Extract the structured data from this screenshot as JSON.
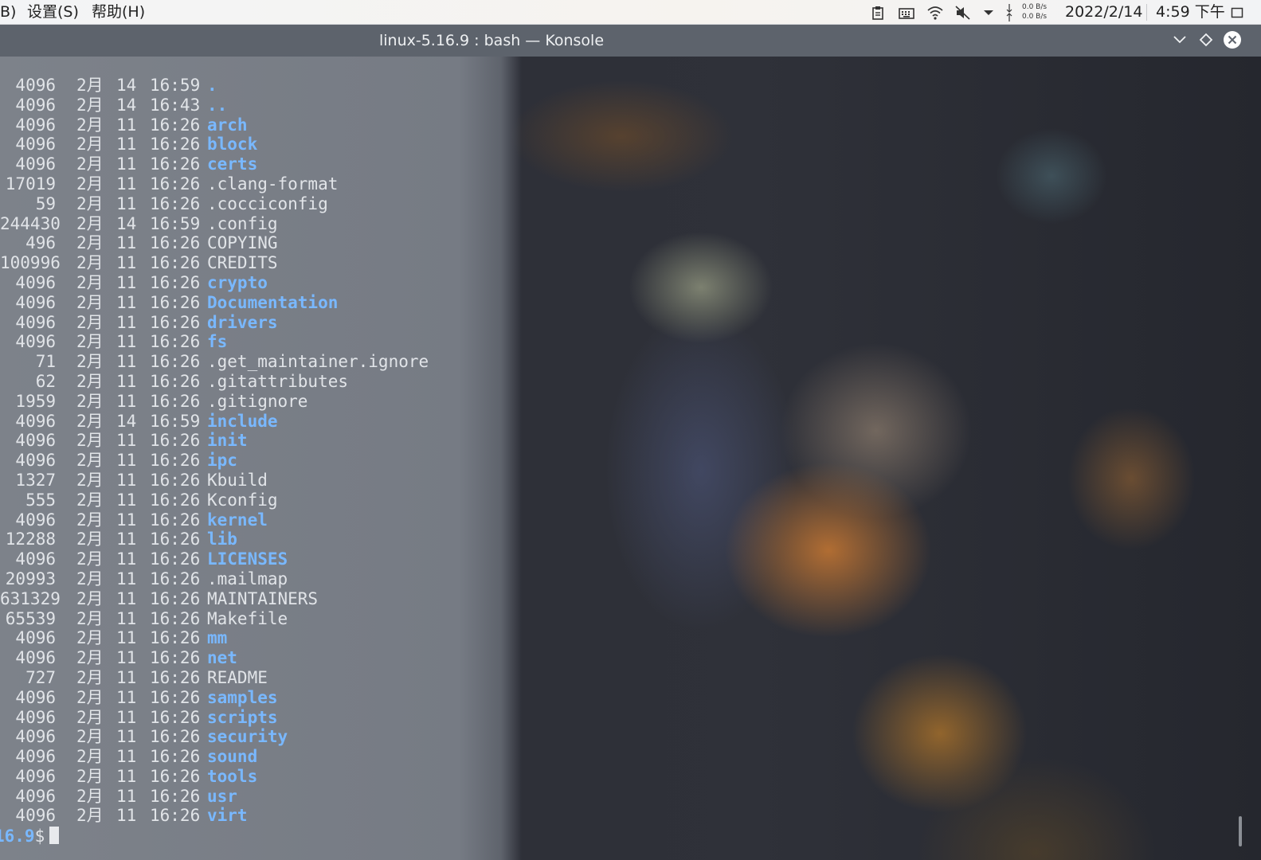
{
  "menubar": {
    "items": [
      {
        "id": "menu-bookmarks-partial",
        "label": "B)"
      },
      {
        "id": "menu-settings",
        "label": "设置(S)"
      },
      {
        "id": "menu-help",
        "label": "帮助(H)"
      }
    ]
  },
  "tray": {
    "icons": [
      "clipboard-icon",
      "keyboard-icon",
      "wifi-icon",
      "volume-muted-icon",
      "chevron-down-icon",
      "network-transfer-icon"
    ],
    "net_down": "0.0 B/s",
    "net_up": "0.0 B/s",
    "date": "2022/2/14",
    "time": "4:59 下午",
    "show_desktop_icon": "show-desktop-icon"
  },
  "window": {
    "title": "linux-5.16.9 : bash — Konsole",
    "buttons": [
      "minimize-icon",
      "maximize-icon",
      "close-icon"
    ]
  },
  "terminal": {
    "colors": {
      "directory": "#79b8ff",
      "file": "#e1e4e8",
      "background_tint": "#7d828a"
    },
    "rows": [
      {
        "size": "4096",
        "month": "2月",
        "day": "14",
        "time": "16:59",
        "name": ".",
        "is_dir": true
      },
      {
        "size": "4096",
        "month": "2月",
        "day": "14",
        "time": "16:43",
        "name": "..",
        "is_dir": true
      },
      {
        "size": "4096",
        "month": "2月",
        "day": "11",
        "time": "16:26",
        "name": "arch",
        "is_dir": true
      },
      {
        "size": "4096",
        "month": "2月",
        "day": "11",
        "time": "16:26",
        "name": "block",
        "is_dir": true
      },
      {
        "size": "4096",
        "month": "2月",
        "day": "11",
        "time": "16:26",
        "name": "certs",
        "is_dir": true
      },
      {
        "size": "17019",
        "month": "2月",
        "day": "11",
        "time": "16:26",
        "name": ".clang-format",
        "is_dir": false
      },
      {
        "size": "59",
        "month": "2月",
        "day": "11",
        "time": "16:26",
        "name": ".cocciconfig",
        "is_dir": false
      },
      {
        "size": "244430",
        "month": "2月",
        "day": "14",
        "time": "16:59",
        "name": ".config",
        "is_dir": false
      },
      {
        "size": "496",
        "month": "2月",
        "day": "11",
        "time": "16:26",
        "name": "COPYING",
        "is_dir": false
      },
      {
        "size": "100996",
        "month": "2月",
        "day": "11",
        "time": "16:26",
        "name": "CREDITS",
        "is_dir": false
      },
      {
        "size": "4096",
        "month": "2月",
        "day": "11",
        "time": "16:26",
        "name": "crypto",
        "is_dir": true
      },
      {
        "size": "4096",
        "month": "2月",
        "day": "11",
        "time": "16:26",
        "name": "Documentation",
        "is_dir": true
      },
      {
        "size": "4096",
        "month": "2月",
        "day": "11",
        "time": "16:26",
        "name": "drivers",
        "is_dir": true
      },
      {
        "size": "4096",
        "month": "2月",
        "day": "11",
        "time": "16:26",
        "name": "fs",
        "is_dir": true
      },
      {
        "size": "71",
        "month": "2月",
        "day": "11",
        "time": "16:26",
        "name": ".get_maintainer.ignore",
        "is_dir": false
      },
      {
        "size": "62",
        "month": "2月",
        "day": "11",
        "time": "16:26",
        "name": ".gitattributes",
        "is_dir": false
      },
      {
        "size": "1959",
        "month": "2月",
        "day": "11",
        "time": "16:26",
        "name": ".gitignore",
        "is_dir": false
      },
      {
        "size": "4096",
        "month": "2月",
        "day": "14",
        "time": "16:59",
        "name": "include",
        "is_dir": true
      },
      {
        "size": "4096",
        "month": "2月",
        "day": "11",
        "time": "16:26",
        "name": "init",
        "is_dir": true
      },
      {
        "size": "4096",
        "month": "2月",
        "day": "11",
        "time": "16:26",
        "name": "ipc",
        "is_dir": true
      },
      {
        "size": "1327",
        "month": "2月",
        "day": "11",
        "time": "16:26",
        "name": "Kbuild",
        "is_dir": false
      },
      {
        "size": "555",
        "month": "2月",
        "day": "11",
        "time": "16:26",
        "name": "Kconfig",
        "is_dir": false
      },
      {
        "size": "4096",
        "month": "2月",
        "day": "11",
        "time": "16:26",
        "name": "kernel",
        "is_dir": true
      },
      {
        "size": "12288",
        "month": "2月",
        "day": "11",
        "time": "16:26",
        "name": "lib",
        "is_dir": true
      },
      {
        "size": "4096",
        "month": "2月",
        "day": "11",
        "time": "16:26",
        "name": "LICENSES",
        "is_dir": true
      },
      {
        "size": "20993",
        "month": "2月",
        "day": "11",
        "time": "16:26",
        "name": ".mailmap",
        "is_dir": false
      },
      {
        "size": "631329",
        "month": "2月",
        "day": "11",
        "time": "16:26",
        "name": "MAINTAINERS",
        "is_dir": false
      },
      {
        "size": "65539",
        "month": "2月",
        "day": "11",
        "time": "16:26",
        "name": "Makefile",
        "is_dir": false
      },
      {
        "size": "4096",
        "month": "2月",
        "day": "11",
        "time": "16:26",
        "name": "mm",
        "is_dir": true
      },
      {
        "size": "4096",
        "month": "2月",
        "day": "11",
        "time": "16:26",
        "name": "net",
        "is_dir": true
      },
      {
        "size": "727",
        "month": "2月",
        "day": "11",
        "time": "16:26",
        "name": "README",
        "is_dir": false
      },
      {
        "size": "4096",
        "month": "2月",
        "day": "11",
        "time": "16:26",
        "name": "samples",
        "is_dir": true
      },
      {
        "size": "4096",
        "month": "2月",
        "day": "11",
        "time": "16:26",
        "name": "scripts",
        "is_dir": true
      },
      {
        "size": "4096",
        "month": "2月",
        "day": "11",
        "time": "16:26",
        "name": "security",
        "is_dir": true
      },
      {
        "size": "4096",
        "month": "2月",
        "day": "11",
        "time": "16:26",
        "name": "sound",
        "is_dir": true
      },
      {
        "size": "4096",
        "month": "2月",
        "day": "11",
        "time": "16:26",
        "name": "tools",
        "is_dir": true
      },
      {
        "size": "4096",
        "month": "2月",
        "day": "11",
        "time": "16:26",
        "name": "usr",
        "is_dir": true
      },
      {
        "size": "4096",
        "month": "2月",
        "day": "11",
        "time": "16:26",
        "name": "virt",
        "is_dir": true
      }
    ],
    "prompt_path": "16.9",
    "prompt_symbol": "$"
  }
}
